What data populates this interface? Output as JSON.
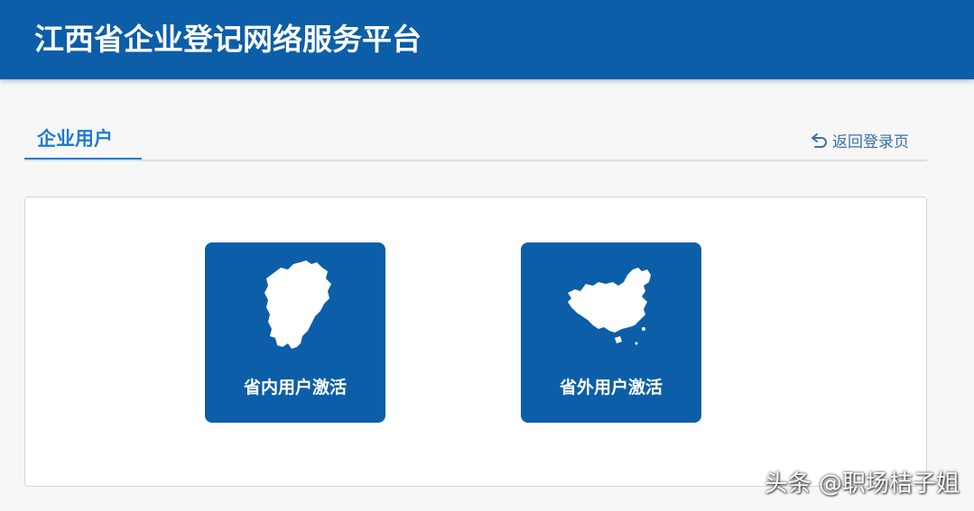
{
  "header": {
    "title": "江西省企业登记网络服务平台"
  },
  "tabs": {
    "active_label": "企业用户"
  },
  "back_link": {
    "label": "返回登录页",
    "icon": "return-arrow-icon"
  },
  "cards": [
    {
      "label": "省内用户激活",
      "icon": "jiangxi-map-icon"
    },
    {
      "label": "省外用户激活",
      "icon": "china-map-icon"
    }
  ],
  "watermark": {
    "text": "头条 @职场桔子姐"
  },
  "colors": {
    "brand_blue": "#0c5ea8",
    "tab_active": "#1f7ad4",
    "link": "#3a6fa8",
    "page_bg": "#f7f7f7"
  }
}
